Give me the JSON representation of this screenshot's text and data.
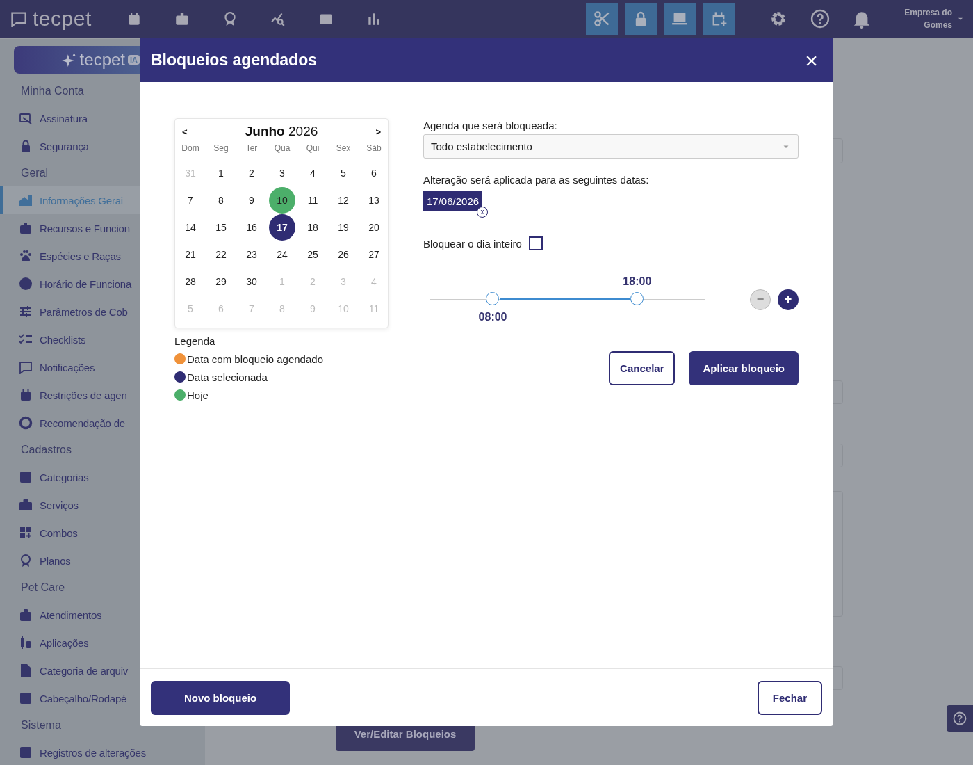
{
  "top_bar": {
    "logo": "tecpet",
    "user": {
      "name": "Empresa do Gomes"
    }
  },
  "sidebar": {
    "ai_button": {
      "label": "tecpet",
      "badge": "IA"
    },
    "sections": [
      {
        "heading": "Minha Conta",
        "items": [
          {
            "label": "Assinatura",
            "selected": false
          },
          {
            "label": "Segurança",
            "selected": false
          }
        ]
      },
      {
        "heading": "Geral",
        "items": [
          {
            "label": "Informações Gerai",
            "selected": true
          },
          {
            "label": "Recursos e Funcion",
            "selected": false
          },
          {
            "label": "Espécies e Raças",
            "selected": false
          },
          {
            "label": "Horário de Funciona",
            "selected": false
          },
          {
            "label": "Parâmetros de Cob",
            "selected": false
          },
          {
            "label": "Checklists",
            "selected": false
          },
          {
            "label": "Notificações",
            "selected": false
          },
          {
            "label": "Restrições de agen",
            "selected": false
          },
          {
            "label": "Recomendação de",
            "selected": false
          }
        ]
      },
      {
        "heading": "Cadastros",
        "items": [
          {
            "label": "Categorias",
            "selected": false
          },
          {
            "label": "Serviços",
            "selected": false
          },
          {
            "label": "Combos",
            "selected": false
          },
          {
            "label": "Planos",
            "selected": false
          }
        ]
      },
      {
        "heading": "Pet Care",
        "items": [
          {
            "label": "Atendimentos",
            "selected": false
          },
          {
            "label": "Aplicações",
            "selected": false
          },
          {
            "label": "Categoria de arquiv",
            "selected": false
          },
          {
            "label": "Cabeçalho/Rodapé",
            "selected": false
          }
        ]
      },
      {
        "heading": "Sistema",
        "items": [
          {
            "label": "Registros de alterações",
            "selected": false
          }
        ]
      }
    ]
  },
  "page": {
    "edit_button": "Ver/Editar Bloqueios"
  },
  "modal": {
    "title": "Bloqueios agendados",
    "close": "×",
    "calendar": {
      "prev": "<",
      "next": ">",
      "month": "Junho",
      "year": "2026",
      "weekdays": [
        "Dom",
        "Seg",
        "Ter",
        "Qua",
        "Qui",
        "Sex",
        "Sáb"
      ],
      "weeks": [
        [
          {
            "day": "31",
            "muted": true,
            "today": false,
            "selected": false
          },
          {
            "day": "1",
            "muted": false,
            "today": false,
            "selected": false
          },
          {
            "day": "2",
            "muted": false,
            "today": false,
            "selected": false
          },
          {
            "day": "3",
            "muted": false,
            "today": false,
            "selected": false
          },
          {
            "day": "4",
            "muted": false,
            "today": false,
            "selected": false
          },
          {
            "day": "5",
            "muted": false,
            "today": false,
            "selected": false
          },
          {
            "day": "6",
            "muted": false,
            "today": false,
            "selected": false
          }
        ],
        [
          {
            "day": "7",
            "muted": false,
            "today": false,
            "selected": false
          },
          {
            "day": "8",
            "muted": false,
            "today": false,
            "selected": false
          },
          {
            "day": "9",
            "muted": false,
            "today": false,
            "selected": false
          },
          {
            "day": "10",
            "muted": false,
            "today": true,
            "selected": false
          },
          {
            "day": "11",
            "muted": false,
            "today": false,
            "selected": false
          },
          {
            "day": "12",
            "muted": false,
            "today": false,
            "selected": false
          },
          {
            "day": "13",
            "muted": false,
            "today": false,
            "selected": false
          }
        ],
        [
          {
            "day": "14",
            "muted": false,
            "today": false,
            "selected": false
          },
          {
            "day": "15",
            "muted": false,
            "today": false,
            "selected": false
          },
          {
            "day": "16",
            "muted": false,
            "today": false,
            "selected": false
          },
          {
            "day": "17",
            "muted": false,
            "today": false,
            "selected": true
          },
          {
            "day": "18",
            "muted": false,
            "today": false,
            "selected": false
          },
          {
            "day": "19",
            "muted": false,
            "today": false,
            "selected": false
          },
          {
            "day": "20",
            "muted": false,
            "today": false,
            "selected": false
          }
        ],
        [
          {
            "day": "21",
            "muted": false,
            "today": false,
            "selected": false
          },
          {
            "day": "22",
            "muted": false,
            "today": false,
            "selected": false
          },
          {
            "day": "23",
            "muted": false,
            "today": false,
            "selected": false
          },
          {
            "day": "24",
            "muted": false,
            "today": false,
            "selected": false
          },
          {
            "day": "25",
            "muted": false,
            "today": false,
            "selected": false
          },
          {
            "day": "26",
            "muted": false,
            "today": false,
            "selected": false
          },
          {
            "day": "27",
            "muted": false,
            "today": false,
            "selected": false
          }
        ],
        [
          {
            "day": "28",
            "muted": false,
            "today": false,
            "selected": false
          },
          {
            "day": "29",
            "muted": false,
            "today": false,
            "selected": false
          },
          {
            "day": "30",
            "muted": false,
            "today": false,
            "selected": false
          },
          {
            "day": "1",
            "muted": true,
            "today": false,
            "selected": false
          },
          {
            "day": "2",
            "muted": true,
            "today": false,
            "selected": false
          },
          {
            "day": "3",
            "muted": true,
            "today": false,
            "selected": false
          },
          {
            "day": "4",
            "muted": true,
            "today": false,
            "selected": false
          }
        ],
        [
          {
            "day": "5",
            "muted": true,
            "today": false,
            "selected": false
          },
          {
            "day": "6",
            "muted": true,
            "today": false,
            "selected": false
          },
          {
            "day": "7",
            "muted": true,
            "today": false,
            "selected": false
          },
          {
            "day": "8",
            "muted": true,
            "today": false,
            "selected": false
          },
          {
            "day": "9",
            "muted": true,
            "today": false,
            "selected": false
          },
          {
            "day": "10",
            "muted": true,
            "today": false,
            "selected": false
          },
          {
            "day": "11",
            "muted": true,
            "today": false,
            "selected": false
          }
        ]
      ]
    },
    "legend": {
      "title": "Legenda",
      "items": [
        {
          "label": "Data com bloqueio agendado",
          "color": "#f0923a"
        },
        {
          "label": "Data selecionada",
          "color": "#2f2c73"
        },
        {
          "label": "Hoje",
          "color": "#4caf6a"
        }
      ]
    },
    "form": {
      "schedule_label": "Agenda que será bloqueada:",
      "schedule_select": {
        "value": "Todo estabelecimento"
      },
      "dates_label": "Alteração será aplicada para as seguintes datas:",
      "dates": [
        {
          "label": "17/06/2026",
          "remove": "x"
        }
      ],
      "full_day": {
        "label": "Bloquear o dia inteiro",
        "checked": false
      },
      "time_range": {
        "start": {
          "label": "08:00",
          "level": 0.228
        },
        "end": {
          "label": "18:00",
          "level": 0.754
        }
      },
      "steppers": [
        {
          "label": "−",
          "disabled": true
        },
        {
          "label": "+",
          "disabled": false
        }
      ],
      "actions": [
        {
          "label": "Cancelar",
          "kind": "outline"
        },
        {
          "label": "Aplicar bloqueio",
          "kind": "primary"
        }
      ]
    },
    "footer": [
      {
        "label": "Novo bloqueio",
        "kind": "primary"
      },
      {
        "label": "Fechar",
        "kind": "outline"
      }
    ]
  }
}
